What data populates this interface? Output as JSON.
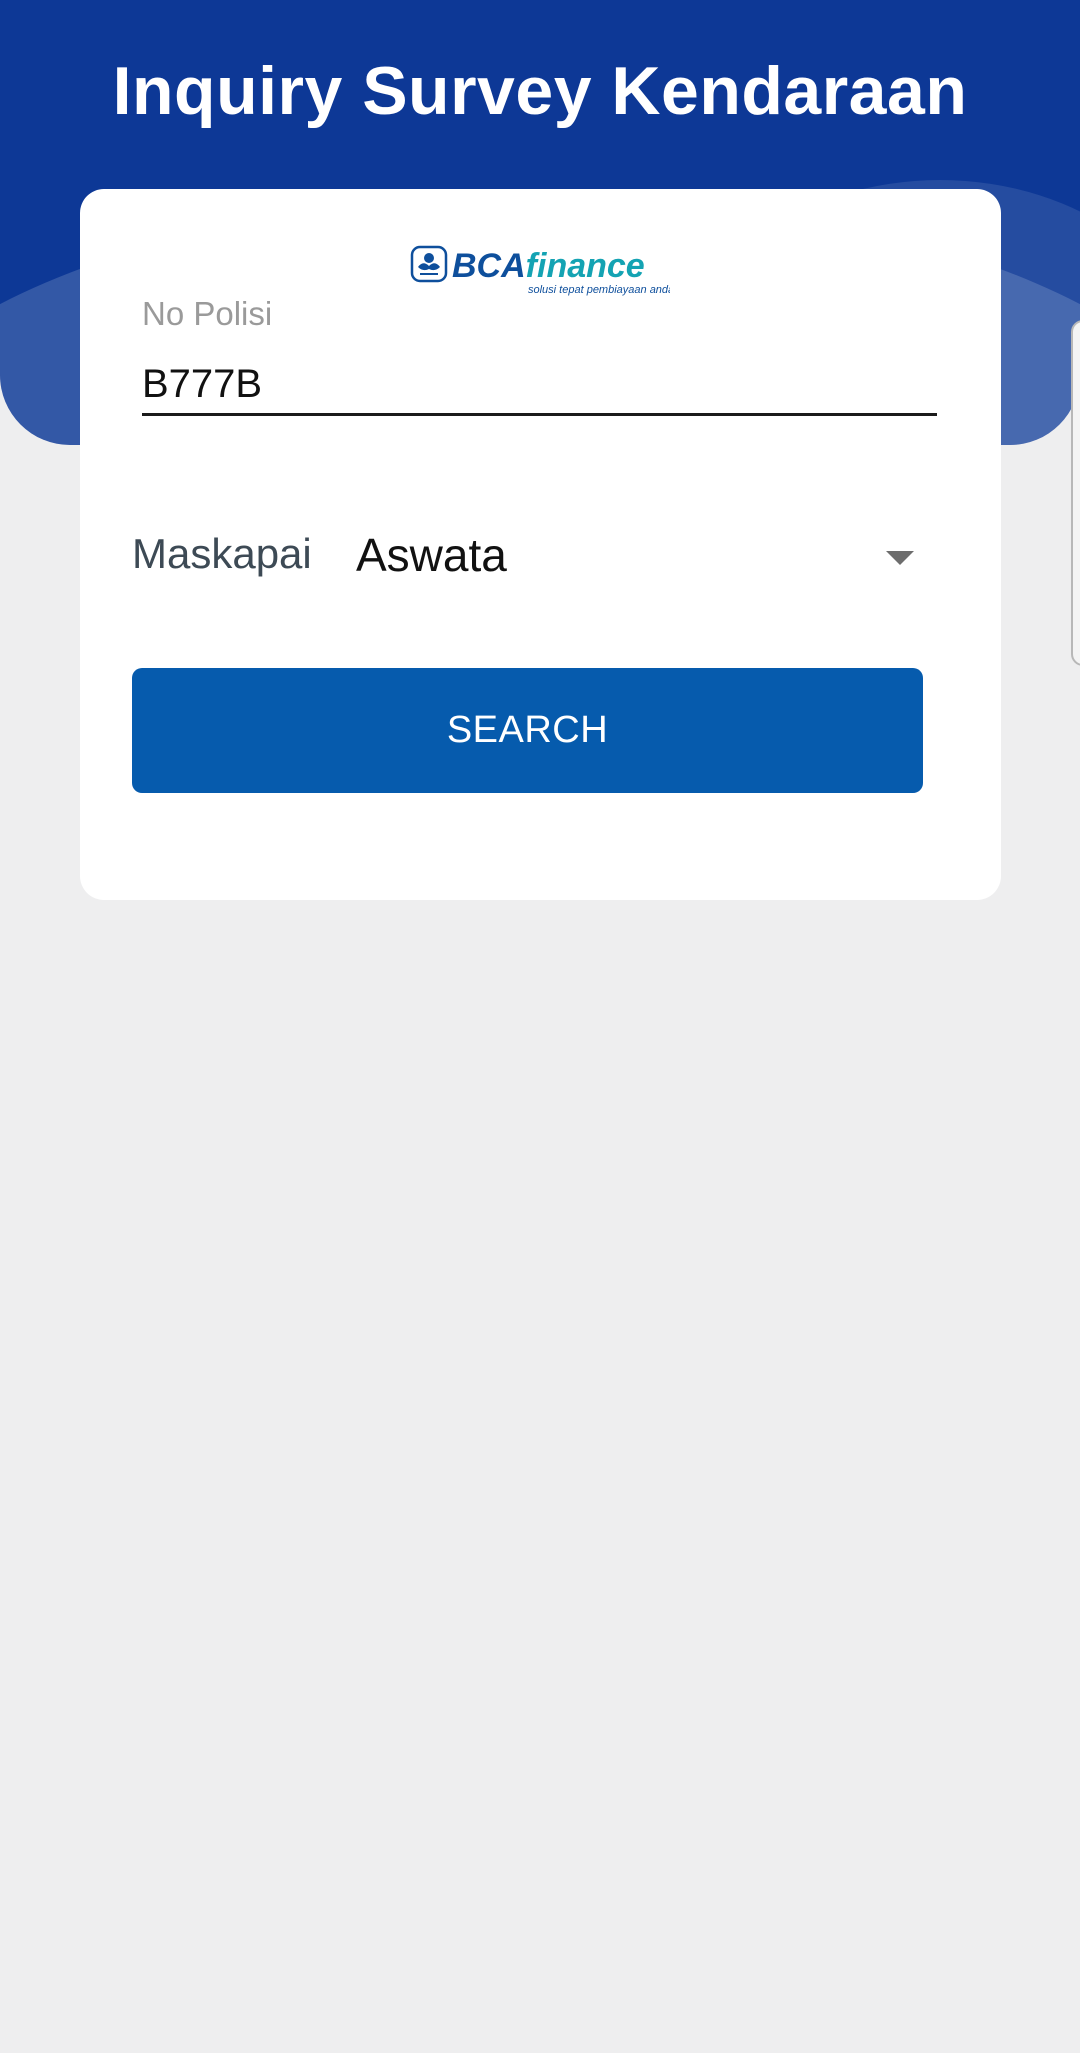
{
  "header": {
    "title": "Inquiry Survey Kendaraan",
    "background_color": "#0d3896"
  },
  "logo": {
    "brand_bold": "BCA",
    "brand_light": "finance",
    "tagline": "solusi tepat pembiayaan anda",
    "primary_color": "#0e4f9c",
    "secondary_color": "#14a3b3"
  },
  "form": {
    "no_polisi": {
      "label": "No Polisi",
      "value": "B777B"
    },
    "maskapai": {
      "label": "Maskapai",
      "selected": "Aswata",
      "icon": "chevron-down-icon"
    },
    "search_button": {
      "label": "SEARCH",
      "color": "#065bad"
    }
  }
}
